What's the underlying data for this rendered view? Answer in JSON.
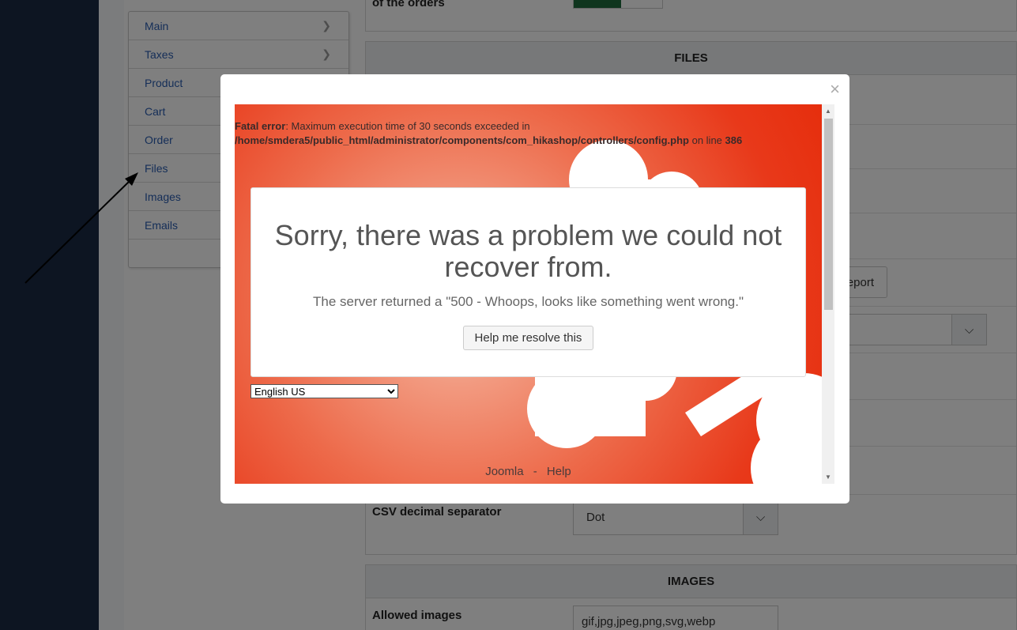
{
  "nav": {
    "items": [
      {
        "label": "Main",
        "chevron": true
      },
      {
        "label": "Taxes",
        "chevron": true
      },
      {
        "label": "Product",
        "chevron": false
      },
      {
        "label": "Cart",
        "chevron": false
      },
      {
        "label": "Order",
        "chevron": false
      },
      {
        "label": "Files",
        "chevron": false
      },
      {
        "label": "Images",
        "chevron": false
      },
      {
        "label": "Emails",
        "chevron": false
      }
    ]
  },
  "top_panel": {
    "label": "of the orders"
  },
  "files_panel": {
    "title": "FILES",
    "report_button": "eport",
    "csv_decimal_label": "CSV decimal separator",
    "csv_decimal_value": "Dot"
  },
  "images_panel": {
    "title": "IMAGES",
    "allowed_label": "Allowed images",
    "allowed_value": "gif,jpg,jpeg,png,svg,webp"
  },
  "modal": {
    "close": "×",
    "fatal_label": "Fatal error",
    "fatal_message": ": Maximum execution time of 30 seconds exceeded in",
    "fatal_path": "/home/smdera5/public_html/administrator/components/com_hikashop/controllers/config.php",
    "fatal_online": " on line ",
    "fatal_line": "386",
    "heading": "Sorry, there was a problem we could not recover from.",
    "server_message": "The server returned a \"500 - Whoops, looks like something went wrong.\"",
    "help_button": "Help me resolve this",
    "language": "English US",
    "footer_joomla": "Joomla",
    "footer_sep": "-",
    "footer_help": "Help"
  }
}
